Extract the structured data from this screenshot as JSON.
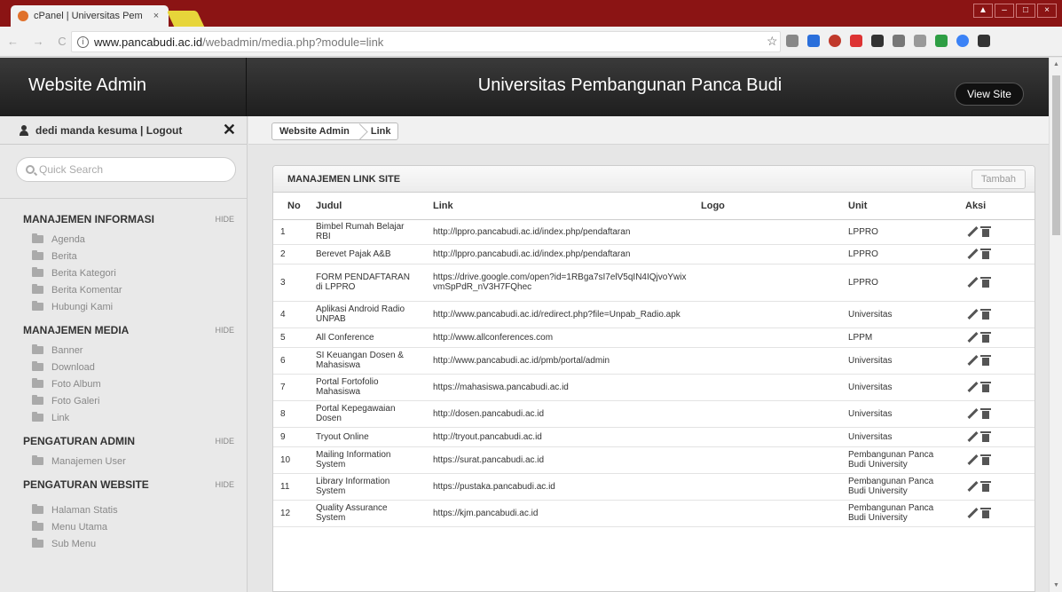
{
  "browser": {
    "tab_title": "cPanel | Universitas Pem",
    "tab_close": "×",
    "url_host": "www.pancabudi.ac.id",
    "url_path": "/webadmin/media.php?module=link",
    "nav_glyphs": "← → C"
  },
  "header": {
    "brand": "Website Admin",
    "site_title": "Universitas Pembangunan Panca Budi",
    "view_site": "View Site"
  },
  "sidebar": {
    "user": "dedi manda kesuma | Logout",
    "close": "✕",
    "search_placeholder": "Quick Search",
    "sections": [
      {
        "title": "MANAJEMEN INFORMASI",
        "hide": "HIDE",
        "items": [
          "Agenda",
          "Berita",
          "Berita Kategori",
          "Berita Komentar",
          "Hubungi Kami"
        ]
      },
      {
        "title": "MANAJEMEN MEDIA",
        "hide": "HIDE",
        "items": [
          "Banner",
          "Download",
          "Foto Album",
          "Foto Galeri",
          "Link"
        ]
      },
      {
        "title": "PENGATURAN ADMIN",
        "hide": "HIDE",
        "items": [
          "Manajemen User"
        ]
      },
      {
        "title": "PENGATURAN WEBSITE",
        "hide": "HIDE",
        "items": [
          "Halaman Statis",
          "Menu Utama",
          "Sub Menu"
        ]
      }
    ]
  },
  "breadcrumb": {
    "root": "Website Admin",
    "current": "Link"
  },
  "panel": {
    "title": "MANAJEMEN LINK SITE",
    "add_button": "Tambah",
    "columns": {
      "no": "No",
      "judul": "Judul",
      "link": "Link",
      "logo": "Logo",
      "unit": "Unit",
      "aksi": "Aksi"
    },
    "rows": [
      {
        "no": "1",
        "judul": "Bimbel Rumah Belajar RBI",
        "link": "http://lppro.pancabudi.ac.id/index.php/pendaftaran",
        "logo": "",
        "unit": "LPPRO"
      },
      {
        "no": "2",
        "judul": "Berevet Pajak A&B",
        "link": "http://lppro.pancabudi.ac.id/index.php/pendaftaran",
        "logo": "",
        "unit": "LPPRO"
      },
      {
        "no": "3",
        "judul": "FORM PENDAFTARAN di LPPRO",
        "link": "https://drive.google.com/open?id=1RBga7sI7elV5qIN4IQjvoYwixvmSpPdR_nV3H7FQhec",
        "logo": "",
        "unit": "LPPRO"
      },
      {
        "no": "4",
        "judul": "Aplikasi Android Radio UNPAB",
        "link": "http://www.pancabudi.ac.id/redirect.php?file=Unpab_Radio.apk",
        "logo": "",
        "unit": "Universitas"
      },
      {
        "no": "5",
        "judul": "All Conference",
        "link": "http://www.allconferences.com",
        "logo": "",
        "unit": "LPPM"
      },
      {
        "no": "6",
        "judul": "SI Keuangan Dosen & Mahasiswa",
        "link": "http://www.pancabudi.ac.id/pmb/portal/admin",
        "logo": "",
        "unit": "Universitas"
      },
      {
        "no": "7",
        "judul": "Portal Fortofolio Mahasiswa",
        "link": "https://mahasiswa.pancabudi.ac.id",
        "logo": "",
        "unit": "Universitas"
      },
      {
        "no": "8",
        "judul": "Portal Kepegawaian Dosen",
        "link": "http://dosen.pancabudi.ac.id",
        "logo": "",
        "unit": "Universitas"
      },
      {
        "no": "9",
        "judul": "Tryout Online",
        "link": "http://tryout.pancabudi.ac.id",
        "logo": "",
        "unit": "Universitas"
      },
      {
        "no": "10",
        "judul": "Mailing Information System",
        "link": "https://surat.pancabudi.ac.id",
        "logo": "",
        "unit": "Pembangunan Panca Budi University"
      },
      {
        "no": "11",
        "judul": "Library Information System",
        "link": "https://pustaka.pancabudi.ac.id",
        "logo": "",
        "unit": "Pembangunan Panca Budi University"
      },
      {
        "no": "12",
        "judul": "Quality Assurance System",
        "link": "https://kjm.pancabudi.ac.id",
        "logo": "",
        "unit": "Pembangunan Panca Budi University"
      }
    ]
  },
  "colors": {
    "tabbar": "#8b1414",
    "header": "#2a2a2a",
    "sidebar": "#e9e9e9"
  }
}
